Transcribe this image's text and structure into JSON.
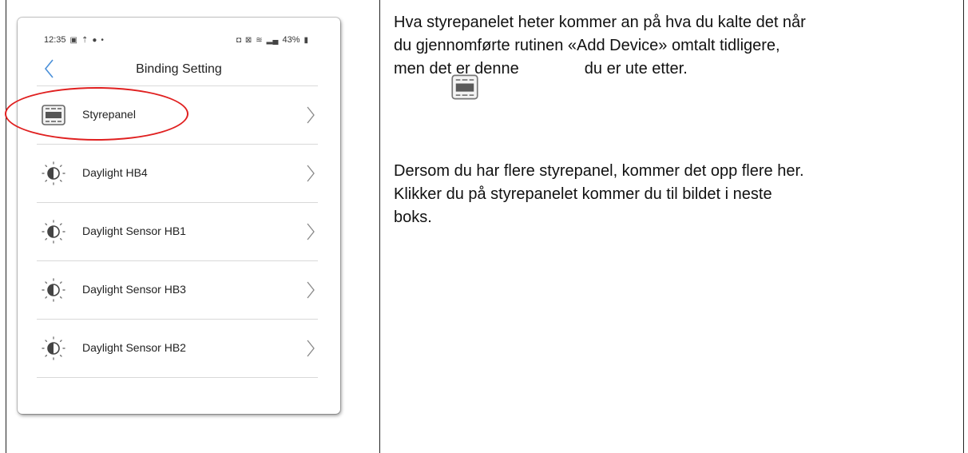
{
  "phone": {
    "status_time": "12:35",
    "status_battery": "43%",
    "title": "Binding Setting",
    "devices": [
      {
        "label": "Styrepanel",
        "icon": "panel-icon"
      },
      {
        "label": "Daylight HB4",
        "icon": "daylight-sensor-icon"
      },
      {
        "label": "Daylight Sensor HB1",
        "icon": "daylight-sensor-icon"
      },
      {
        "label": "Daylight Sensor HB3",
        "icon": "daylight-sensor-icon"
      },
      {
        "label": "Daylight Sensor HB2",
        "icon": "daylight-sensor-icon"
      }
    ]
  },
  "text": {
    "p1_line1": "Hva styrepanelet heter kommer an på hva du kalte det når",
    "p1_line2": "du gjennomførte rutinen «Add Device» omtalt tidligere,",
    "p1_line3a": "men det er denne",
    "p1_line3b": "du er ute etter.",
    "p2_line1": "Dersom du har flere styrepanel, kommer det opp flere her.",
    "p2_line2": "Klikker du på styrepanelet kommer du til bildet i neste",
    "p2_line3": "boks."
  },
  "colors": {
    "highlight": "#e02020",
    "accent_back": "#4a90d9"
  }
}
